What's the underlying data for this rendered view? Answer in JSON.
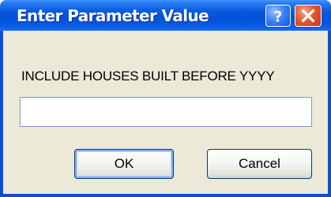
{
  "window": {
    "title": "Enter Parameter Value",
    "title_bar_color": "#0a5be0",
    "help_icon": "help-icon",
    "close_icon": "close-icon"
  },
  "dialog": {
    "prompt": "INCLUDE HOUSES BUILT BEFORE YYYY",
    "input_value": "",
    "input_placeholder": ""
  },
  "buttons": {
    "ok_label": "OK",
    "cancel_label": "Cancel"
  }
}
